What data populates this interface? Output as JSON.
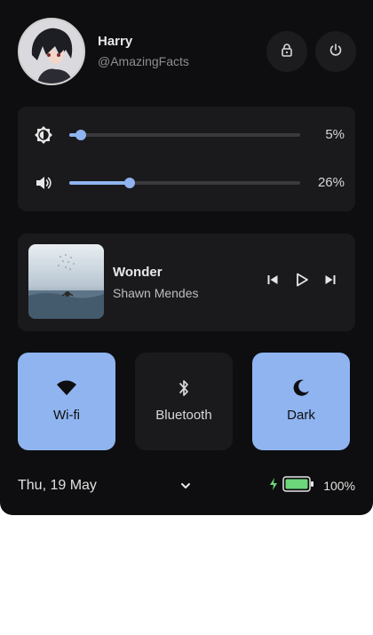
{
  "user": {
    "name": "Harry",
    "handle": "@AmazingFacts"
  },
  "header": {
    "lock_icon": "lock-icon",
    "power_icon": "power-icon"
  },
  "sliders": {
    "brightness": {
      "icon": "brightness-icon",
      "value": "5%",
      "level": 0.05
    },
    "volume": {
      "icon": "volume-icon",
      "value": "26%",
      "level": 0.26
    }
  },
  "media": {
    "title": "Wonder",
    "artist": "Shawn Mendes",
    "controls": [
      "previous-icon",
      "play-icon",
      "next-icon"
    ]
  },
  "toggles": [
    {
      "label": "Wi-fi",
      "icon": "wifi-icon",
      "active": true
    },
    {
      "label": "Bluetooth",
      "icon": "bluetooth-icon",
      "active": false
    },
    {
      "label": "Dark",
      "icon": "moon-icon",
      "active": true
    }
  ],
  "footer": {
    "date": "Thu, 19 May",
    "battery_percent": "100%",
    "battery_level": 1.0,
    "charging": true
  },
  "colors": {
    "panel_bg": "#0e0e10",
    "card_bg": "#1a1a1c",
    "accent": "#8fb4f0",
    "battery_green": "#6cd67a"
  }
}
